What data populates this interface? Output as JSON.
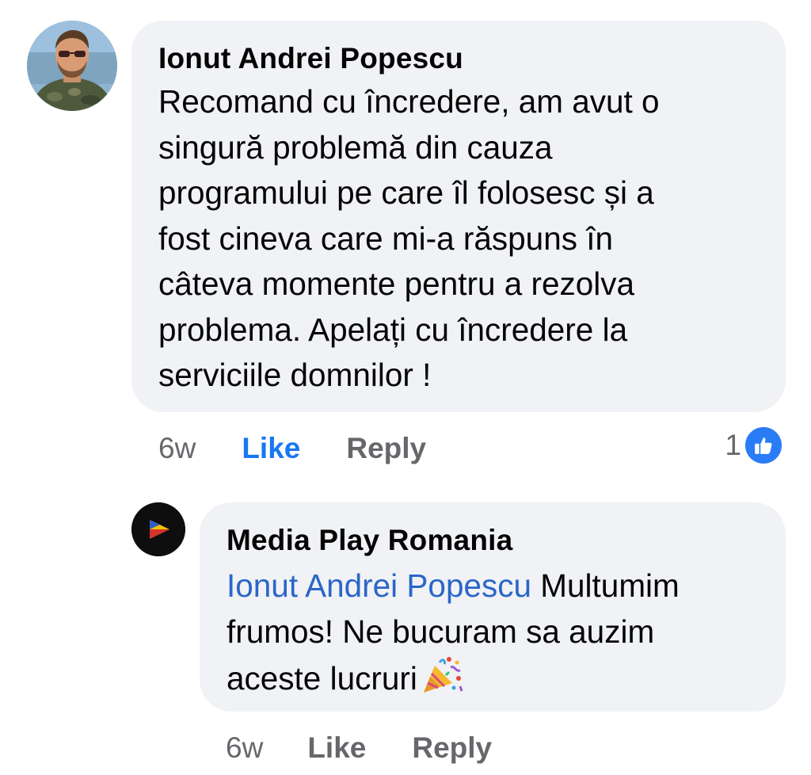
{
  "comment": {
    "author": "Ionut Andrei Popescu",
    "text": "Recomand cu încredere, am avut o\nsingură problemă din cauza\nprogramului pe care îl folosesc și a\nfost cineva care mi-a răspuns în\ncâteva momente pentru a rezolva\nproblema. Apelați cu încredere la\nserviciile domnilor !",
    "time": "6w",
    "like_label": "Like",
    "reply_label": "Reply",
    "reaction_count": "1",
    "reaction_icon": "thumbs-up-icon",
    "like_color": "#1877f2"
  },
  "reply": {
    "author": "Media Play Romania",
    "mention": "Ionut Andrei Popescu",
    "text": " Multumim\nfrumos! Ne bucuram sa auzim\naceste lucruri",
    "emoji": "party-popper-icon",
    "time": "6w",
    "like_label": "Like",
    "reply_label": "Reply"
  },
  "colors": {
    "bubble": "#f0f2f5",
    "meta": "#65676b",
    "mention": "#2b66c8"
  }
}
